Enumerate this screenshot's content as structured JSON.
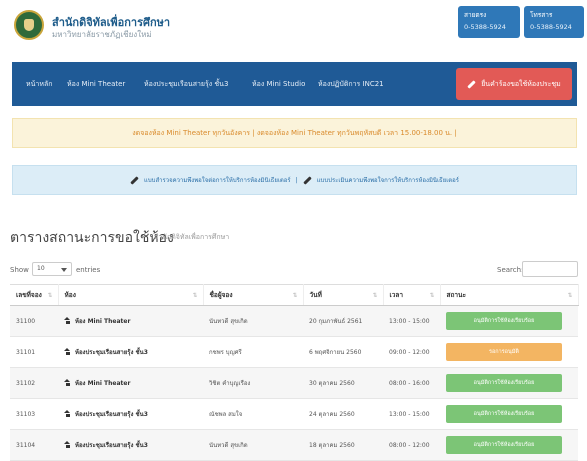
{
  "header": {
    "org_name": "สำนักดิจิทัลเพื่อการศึกษา",
    "org_sub": "มหาวิทยาลัยราชภัฏเชียงใหม่",
    "contact_left": {
      "label": "สายตรง",
      "number": "0-5388-5924"
    },
    "contact_right": {
      "label": "โทรสาร",
      "number": "0-5388-5924"
    }
  },
  "nav": {
    "items": [
      "หน้าหลัก",
      "ห้อง Mini Theater",
      "ห้องประชุมเรือนสายรุ้ง ชั้น3",
      "ห้อง Mini Studio",
      "ห้องปฏิบัติการ INC21"
    ],
    "book_button": "ยื่นคำร้องขอใช้ห้องประชุม"
  },
  "alerts": {
    "warning": "งดจองห้อง Mini Theater ทุกวันอังคาร | งดจองห้อง Mini Theater ทุกวันพฤหัสบดี เวลา 15.00-18.00 น. |",
    "info_left": "แบบสำรวจความพึงพอใจต่อการให้บริการห้องมินิเธียเตอร์",
    "info_sep": "|",
    "info_right": "แบบประเมินความพึงพอใจการให้บริการห้องมินิเธียเตอร์"
  },
  "page": {
    "title": "ตารางสถานะการขอใช้ห้อง",
    "subtitle": "สำนักดิจิทัลเพื่อการศึกษา"
  },
  "table_controls": {
    "show_label": "Show",
    "show_value": "10",
    "entries_label": "entries",
    "search_label": "Search:"
  },
  "table": {
    "headers": [
      "เลขที่จอง",
      "ห้อง",
      "ชื่อผู้จอง",
      "วันที่",
      "เวลา",
      "สถานะ"
    ],
    "rows": [
      {
        "id": "31100",
        "room": "ห้อง Mini Theater",
        "name": "นันทวดี สุขเกิด",
        "date": "20 กุมภาพันธ์ 2561",
        "time": "13:00 - 15:00",
        "status": "อนุมัติการใช้ห้องเรียบร้อย",
        "status_type": "approved"
      },
      {
        "id": "31101",
        "room": "ห้องประชุมเรือนสายรุ้ง ชั้น3",
        "name": "กชพร บุญศรี",
        "date": "6 พฤศจิกายน 2560",
        "time": "09:00 - 12:00",
        "status": "รอการอนุมัติ",
        "status_type": "pending"
      },
      {
        "id": "31102",
        "room": "ห้อง Mini Theater",
        "name": "วิชิต คำบุญเรือง",
        "date": "30 ตุลาคม 2560",
        "time": "08:00 - 16:00",
        "status": "อนุมัติการใช้ห้องเรียบร้อย",
        "status_type": "approved"
      },
      {
        "id": "31103",
        "room": "ห้องประชุมเรือนสายรุ้ง ชั้น3",
        "name": "ณัชพล สมใจ",
        "date": "24 ตุลาคม 2560",
        "time": "13:00 - 15:00",
        "status": "อนุมัติการใช้ห้องเรียบร้อย",
        "status_type": "approved"
      },
      {
        "id": "31104",
        "room": "ห้องประชุมเรือนสายรุ้ง ชั้น3",
        "name": "นันทวดี สุขเกิด",
        "date": "18 ตุลาคม 2560",
        "time": "08:00 - 12:00",
        "status": "อนุมัติการใช้ห้องเรียบร้อย",
        "status_type": "approved"
      }
    ]
  },
  "colors": {
    "navbar": "#1f5a96",
    "book_button": "#e25a56",
    "contact_button": "#2f78b8",
    "status_approved": "#7cc576",
    "status_pending": "#f3b562"
  }
}
